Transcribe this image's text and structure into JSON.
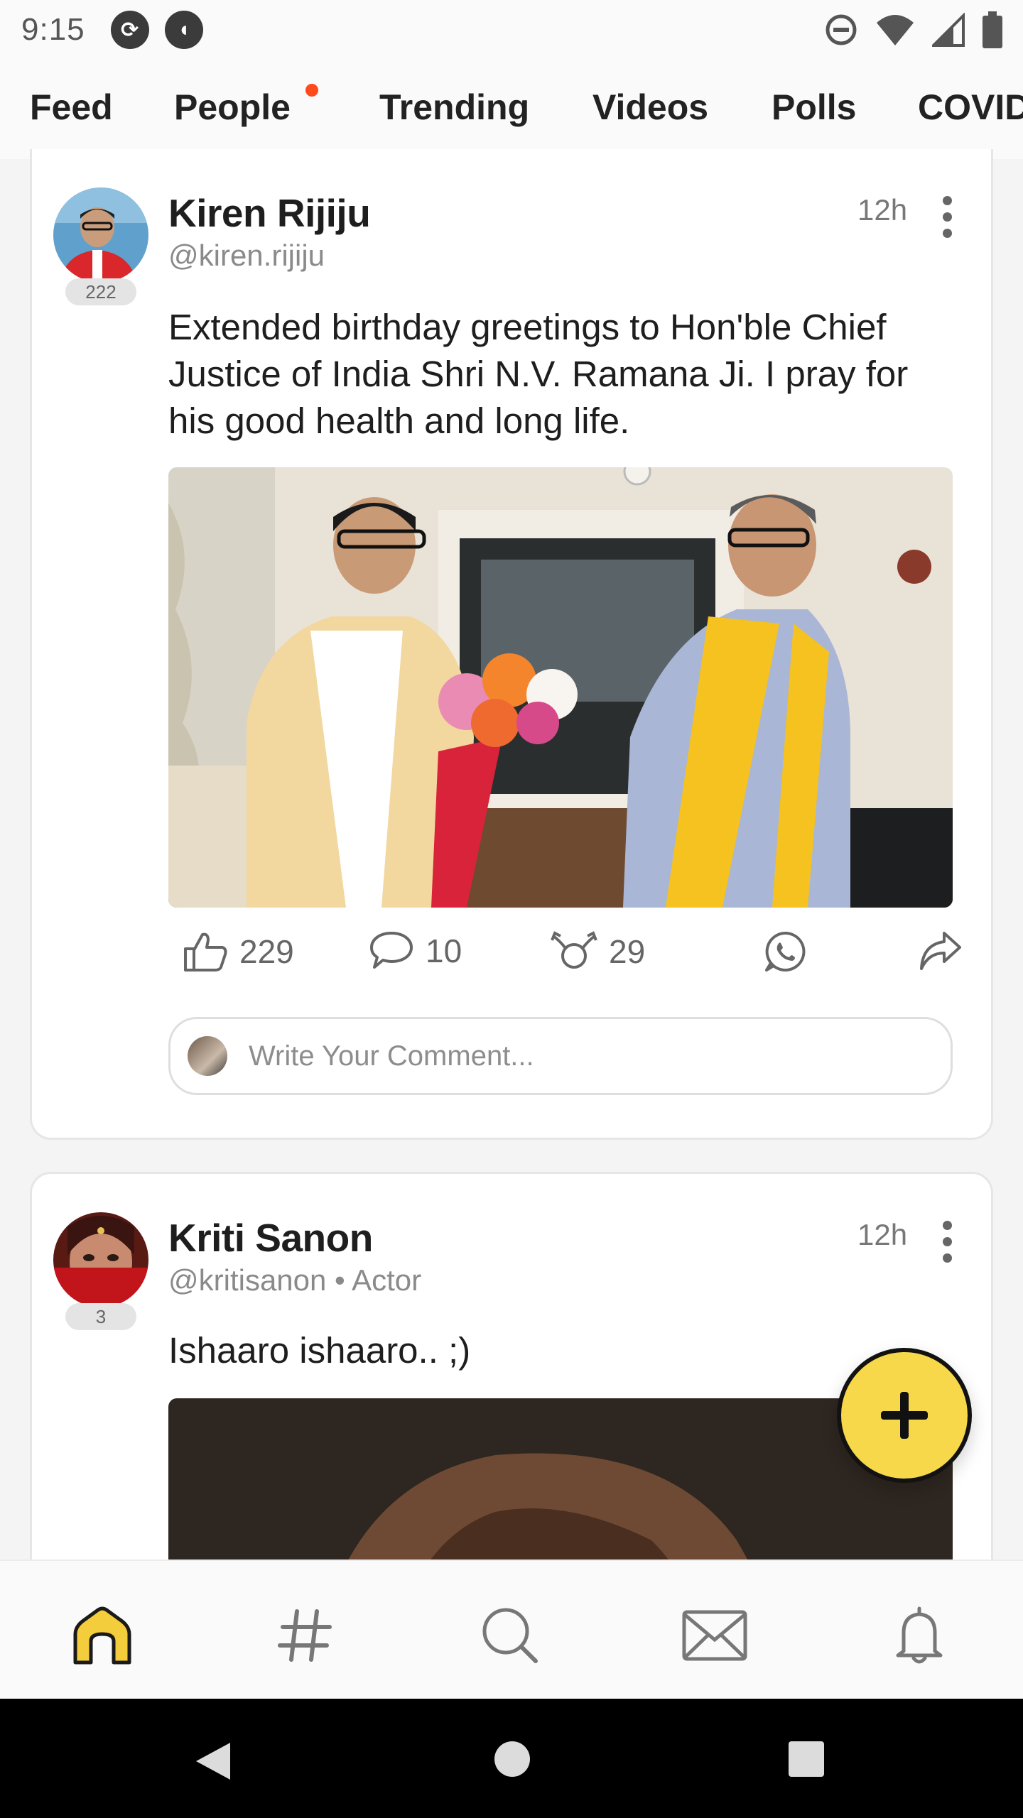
{
  "status_bar": {
    "time": "9:15",
    "left_icons": [
      "sync-icon",
      "pocket-icon"
    ],
    "right_icons": [
      "do-not-disturb-icon",
      "wifi-icon",
      "cell-signal-icon",
      "battery-icon"
    ]
  },
  "tabs": [
    {
      "label": "Feed",
      "active": true
    },
    {
      "label": "People",
      "has_dot": true
    },
    {
      "label": "Trending"
    },
    {
      "label": "Videos"
    },
    {
      "label": "Polls"
    },
    {
      "label": "COVID"
    }
  ],
  "posts": [
    {
      "author": "Kiren Rijiju",
      "handle": "@kiren.rijiju",
      "badge": "222",
      "time": "12h",
      "text": "Extended birthday greetings to Hon'ble Chief Justice of India Shri N.V. Ramana Ji. I pray for his good health and long life.",
      "likes": "229",
      "comments": "10",
      "reposts": "29",
      "comment_placeholder": "Write Your Comment..."
    },
    {
      "author": "Kriti Sanon",
      "handle": "@kritisanon • Actor",
      "badge": "3",
      "time": "12h",
      "text": "Ishaaro ishaaro.. ;)"
    }
  ],
  "bottom_nav": [
    "home-icon",
    "hashtag-icon",
    "search-icon",
    "messages-icon",
    "notifications-icon"
  ],
  "colors": {
    "accent": "#f3cd3b",
    "fab": "#f6d84a",
    "notification_dot": "#ff4a1c",
    "text_primary": "#1e1e1e",
    "text_secondary": "#8a8a8a"
  }
}
